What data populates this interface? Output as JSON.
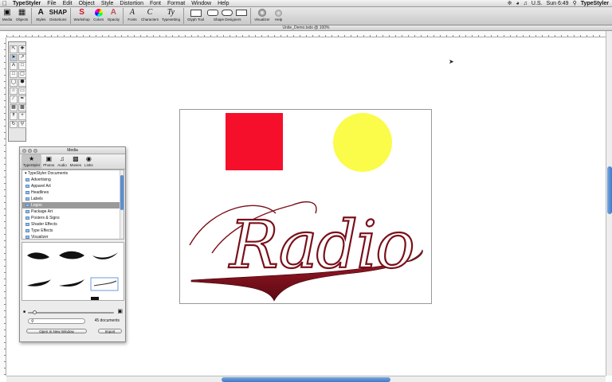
{
  "menubar": {
    "app_name": "TypeStyler",
    "items": [
      "File",
      "Edit",
      "Object",
      "Style",
      "Distortion",
      "Font",
      "Format",
      "Window",
      "Help"
    ],
    "locale": "U.S.",
    "clock": "Sun 6:49",
    "app_right": "TypeStyler"
  },
  "toolbar": {
    "buttons": [
      {
        "label": "Media",
        "icon": "media-icon"
      },
      {
        "label": "Objects",
        "icon": "objects-icon"
      },
      {
        "label": "Styles",
        "icon": "styles-icon"
      },
      {
        "label": "Distortions",
        "icon": "distortions-icon"
      },
      {
        "label": "Workshop",
        "icon": "workshop-icon"
      },
      {
        "label": "Colors",
        "icon": "colors-icon"
      },
      {
        "label": "Opacity",
        "icon": "opacity-icon"
      },
      {
        "label": "Fonts",
        "icon": "fonts-icon"
      },
      {
        "label": "Characters",
        "icon": "characters-icon"
      },
      {
        "label": "Typesetting",
        "icon": "typesetting-icon"
      },
      {
        "label": "Glyph Tool",
        "icon": "glyph-tool-icon"
      },
      {
        "label": "Shape Designers",
        "icon": "shape-designers-icon"
      },
      {
        "label": "Visualizer",
        "icon": "visualizer-icon"
      },
      {
        "label": "Help",
        "icon": "help-icon"
      }
    ]
  },
  "document": {
    "title": "Unite_Demo.tsdx @ 100%",
    "artwork_text": "Radio",
    "colors": {
      "square": "#f50f2a",
      "circle": "#fbfb4a",
      "text": "#7a0f1a"
    }
  },
  "media_panel": {
    "title": "Media",
    "tabs": [
      {
        "label": "TypeStyler",
        "icon": "typestyler-icon"
      },
      {
        "label": "Photos",
        "icon": "photos-icon"
      },
      {
        "label": "Audio",
        "icon": "audio-icon"
      },
      {
        "label": "Movies",
        "icon": "movies-icon"
      },
      {
        "label": "Links",
        "icon": "links-icon"
      }
    ],
    "tree_root": "TypeStyler Documents",
    "folders": [
      "Advertising",
      "Apparel Art",
      "Headlines",
      "Labels",
      "Logos",
      "Package Art",
      "Posters & Signs",
      "Shader Effects",
      "Type Effects",
      "Visualizer"
    ],
    "selected_folder": "Logos",
    "count": "45 documents",
    "open_button": "Open In New Window",
    "import_button": "Import"
  }
}
